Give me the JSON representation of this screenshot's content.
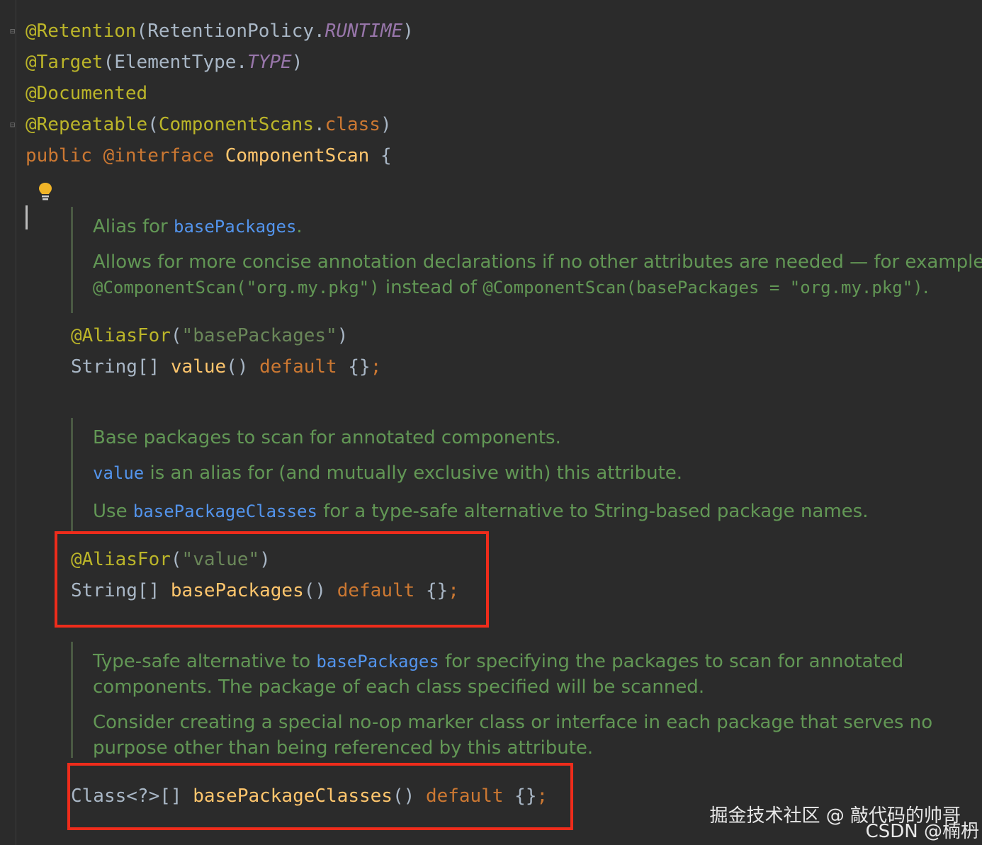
{
  "code": {
    "line1": {
      "annotation": "@Retention",
      "open": "(",
      "type": "RetentionPolicy",
      "dot": ".",
      "field": "RUNTIME",
      "close": ")"
    },
    "line2": {
      "annotation": "@Target",
      "open": "(",
      "type": "ElementType",
      "dot": ".",
      "field": "TYPE",
      "close": ")"
    },
    "line3": {
      "annotation": "@Documented"
    },
    "line4": {
      "annotation": "@Repeatable",
      "open": "(",
      "type": "ComponentScans",
      "dot": ".",
      "keyword": "class",
      "close": ")"
    },
    "line5": {
      "keyword_public": "public",
      "keyword_interface": "@interface",
      "name": "ComponentScan",
      "brace": "{"
    },
    "value_alias": {
      "annotation": "@AliasFor",
      "open": "(",
      "string": "\"basePackages\"",
      "close": ")"
    },
    "value_decl": {
      "type": "String[]",
      "method": "value",
      "parens": "()",
      "default": "default",
      "rest": "{}",
      "semi": ";"
    },
    "basepkg_alias": {
      "annotation": "@AliasFor",
      "open": "(",
      "string": "\"value\"",
      "close": ")"
    },
    "basepkg_decl": {
      "type": "String[]",
      "method": "basePackages",
      "parens": "()",
      "default": "default",
      "rest": "{}",
      "semi": ";"
    },
    "classes_decl": {
      "type": "Class<?>[]",
      "method": "basePackageClasses",
      "parens": "()",
      "default": "default",
      "rest": "{}",
      "semi": ";"
    }
  },
  "docs": {
    "doc1": {
      "p1_prefix": "Alias for ",
      "p1_link": "basePackages",
      "p1_suffix": ".",
      "p2_line1": "Allows for more concise annotation declarations if no other attributes are needed — for example,",
      "p2_code1": "@ComponentScan(\"org.my.pkg\")",
      "p2_mid": " instead of ",
      "p2_code2": "@ComponentScan(basePackages = \"org.my.pkg\")",
      "p2_end": "."
    },
    "doc2": {
      "p1": "Base packages to scan for annotated components.",
      "p2_link": "value",
      "p2_text": " is an alias for (and mutually exclusive with) this attribute.",
      "p3_prefix": "Use ",
      "p3_link": "basePackageClasses",
      "p3_suffix": " for a type-safe alternative to String-based package names."
    },
    "doc3": {
      "p1_prefix": "Type-safe alternative to ",
      "p1_link": "basePackages",
      "p1_suffix": " for specifying the packages to scan for annotated",
      "p1_line2": "components. The package of each class specified will be scanned.",
      "p2_line1": "Consider creating a special no-op marker class or interface in each package that serves no",
      "p2_line2": "purpose other than being referenced by this attribute."
    }
  },
  "icons": {
    "bulb": "lightbulb-icon",
    "fold": "fold-icon"
  },
  "watermark": {
    "line1": "掘金技术社区 @ 敲代码的帅哥",
    "line2": "CSDN @楠枬"
  },
  "colors": {
    "background": "#2b2b2b",
    "annotation": "#bbb529",
    "keyword": "#cc7832",
    "string": "#6a8759",
    "method": "#ffc66d",
    "field": "#9876aa",
    "doc_text": "#629755",
    "doc_link": "#5394ec",
    "highlight": "#ee2c1b"
  }
}
